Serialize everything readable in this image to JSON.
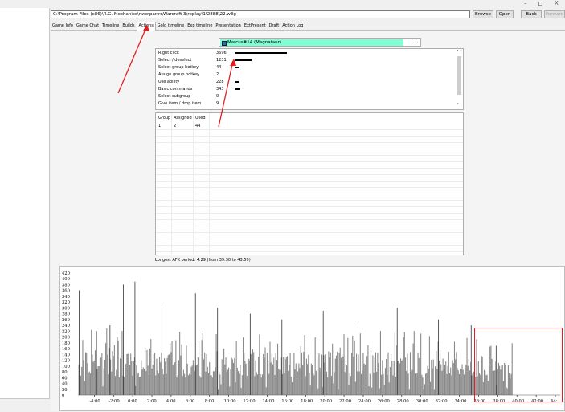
{
  "window": {
    "minimize": "–",
    "restore": "ロ",
    "close": "X"
  },
  "path": {
    "value": "C:\\Program Files (x86)\\R.G. Mechanics\\пиограмм\\Warcraft 3\\replay\\1\\2888\\22.w3g"
  },
  "buttons": {
    "browse": "Browse",
    "open": "Open",
    "back": "Back",
    "forward": "Forward"
  },
  "tabs": [
    "Game Info",
    "Game Chat",
    "Timeline",
    "Builds",
    "Actions",
    "Gold timeline",
    "Exp timeline",
    "Presentation",
    "ExtPresent",
    "Draft",
    "Action Log"
  ],
  "active_tab": "Actions",
  "player": {
    "name": "Marcus#14 (Magnataur)",
    "icon": "player-portrait-icon"
  },
  "actions": [
    {
      "label": "Right click",
      "value": "3696",
      "max_fraction": 1.0
    },
    {
      "label": "Select / deselect",
      "value": "1231",
      "max_fraction": 0.33
    },
    {
      "label": "Select group hotkey",
      "value": "44",
      "max_fraction": 0.012
    },
    {
      "label": "Assign group hotkey",
      "value": "2",
      "max_fraction": 0.0
    },
    {
      "label": "Use ability",
      "value": "228",
      "max_fraction": 0.06
    },
    {
      "label": "Basic commands",
      "value": "343",
      "max_fraction": 0.09
    },
    {
      "label": "Select subgroup",
      "value": "0",
      "max_fraction": 0.0
    },
    {
      "label": "Give item / drop item",
      "value": "9",
      "max_fraction": 0.0
    }
  ],
  "group_table": {
    "columns": [
      "Group",
      "Assigned",
      "Used"
    ],
    "rows": [
      [
        "1",
        "2",
        "44"
      ]
    ]
  },
  "afk": {
    "text": "Longest AFK period: 4:29 (from 39:30 to 43:59)"
  },
  "colors": {
    "accent_select": "#7fffd4",
    "annotation": "#e02020",
    "bar": "#808080"
  },
  "chart_data": {
    "type": "bar",
    "yticks": [
      "420",
      "400",
      "380",
      "360",
      "340",
      "320",
      "300",
      "280",
      "260",
      "240",
      "220",
      "200",
      "180",
      "160",
      "140",
      "120",
      "100",
      "80",
      "60",
      "40",
      "20",
      "0"
    ],
    "ylim": [
      0,
      425
    ],
    "xticks": [
      "-4:00",
      "-2:00",
      "0:00",
      "2:00",
      "4:00",
      "6:00",
      "8:00",
      "10:00",
      "12:00",
      "14:00",
      "16:00",
      "18:00",
      "20:00",
      "22:00",
      "24:00",
      "26:00",
      "28:00",
      "30:00",
      "32:00",
      "34:00",
      "36:00",
      "38:00",
      "40:00",
      "42:00",
      "44:"
    ],
    "xlim_minutes": [
      -5.7,
      44.5
    ],
    "data_end_minutes": 39.5,
    "estimated_spikes": [
      {
        "t": -5.6,
        "v": 360
      },
      {
        "t": -3.8,
        "v": 220
      },
      {
        "t": -2.4,
        "v": 240
      },
      {
        "t": -1.0,
        "v": 380
      },
      {
        "t": 0.2,
        "v": 390
      },
      {
        "t": 3.0,
        "v": 310
      },
      {
        "t": 6.5,
        "v": 350
      },
      {
        "t": 8.8,
        "v": 300
      },
      {
        "t": 12.2,
        "v": 280
      },
      {
        "t": 15.5,
        "v": 260
      },
      {
        "t": 19.8,
        "v": 290
      },
      {
        "t": 23.0,
        "v": 250
      },
      {
        "t": 27.5,
        "v": 300
      },
      {
        "t": 31.8,
        "v": 260
      },
      {
        "t": 35.2,
        "v": 240
      },
      {
        "t": 37.8,
        "v": 170
      }
    ]
  }
}
